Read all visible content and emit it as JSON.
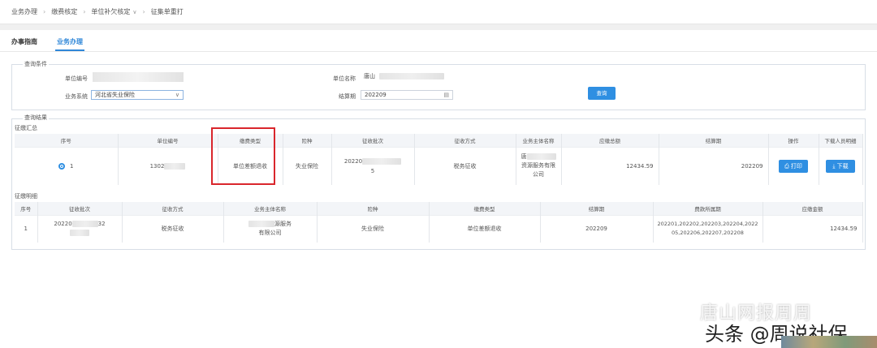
{
  "breadcrumb": {
    "items": [
      "业务办理",
      "缴费核定",
      "单位补欠核定",
      "征集单重打"
    ]
  },
  "tabs": [
    "办事指南",
    "业务办理"
  ],
  "query": {
    "legend": "查询条件",
    "unit_code_label": "单位编号",
    "unit_name_label": "单位名称",
    "unit_name_value": "唐山",
    "business_system_label": "业务系统",
    "business_system_value": "河北省失业保险",
    "settlement_label": "结算期",
    "settlement_value": "202209",
    "query_button": "查询"
  },
  "results": {
    "legend": "查询结果",
    "summary_title": "征缴汇总",
    "summary_headers": [
      "序号",
      "单位编号",
      "缴费类型",
      "险种",
      "征收批次",
      "征收方式",
      "业务主体名称",
      "应缴总额",
      "结算期",
      "操作",
      "下载人员明细"
    ],
    "summary_row": {
      "index": "1",
      "unit_code": "1302",
      "pay_type": "单位差额退收",
      "insurance": "失业保险",
      "batch_top": "20220",
      "batch_bottom": "5",
      "method": "税务征收",
      "entity_line1": "唐",
      "entity_line2": "资源服务有限",
      "entity_line3": "公司",
      "total": "12434.59",
      "period": "202209",
      "print_button": "打印",
      "download_button": "下载"
    },
    "detail_title": "征缴明细",
    "detail_headers": [
      "序号",
      "征收批次",
      "征收方式",
      "业务主体名称",
      "险种",
      "缴费类型",
      "结算期",
      "费款所属期",
      "应缴金额"
    ],
    "detail_row": {
      "index": "1",
      "batch_left": "20220",
      "batch_right": "32",
      "method": "税务征收",
      "entity_line1": "源服务",
      "entity_line2": "有限公司",
      "insurance": "失业保险",
      "pay_type": "单位差额退收",
      "period": "202209",
      "fee_period_line1": "202201,202202,202203,202204,2022",
      "fee_period_line2": "05,202206,202207,202208",
      "amount": "12434.59"
    }
  },
  "watermark": {
    "line1": "唐山网报周周",
    "line2": "头条 @周说社保"
  },
  "icons": [
    "chevron-right-icon",
    "chevron-down-icon",
    "calendar-icon",
    "printer-icon",
    "download-icon",
    "wechat-icon"
  ],
  "colors": {
    "accent": "#2f8fe2",
    "highlight_box": "#d9262c"
  }
}
